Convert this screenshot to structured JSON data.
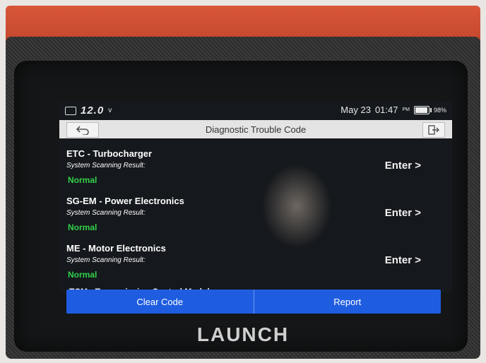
{
  "statusbar": {
    "voltage": "12.0",
    "voltage_unit": "v",
    "date": "May 23",
    "time": "01:47",
    "ampm": "PM",
    "battery": "98%",
    "battery_level": 0.98
  },
  "header": {
    "title": "Diagnostic Trouble Code",
    "back_icon": "back-arrow-icon",
    "exit_icon": "exit-icon"
  },
  "systems": [
    {
      "name": "ETC - Turbocharger",
      "label": "System Scanning Result:",
      "status": "Normal",
      "action": "Enter >"
    },
    {
      "name": "SG-EM - Power Electronics",
      "label": "System Scanning Result:",
      "status": "Normal",
      "action": "Enter >"
    },
    {
      "name": "ME - Motor Electronics",
      "label": "System Scanning Result:",
      "status": "Normal",
      "action": "Enter >"
    }
  ],
  "partial_item": "TCM - Transmission Control Module",
  "footer": {
    "clear_code": "Clear Code",
    "report": "Report"
  },
  "brand": "LAUNCH",
  "colors": {
    "accent": "#1f5de0",
    "normal_status": "#32d14a",
    "device_red": "#c84a30"
  }
}
